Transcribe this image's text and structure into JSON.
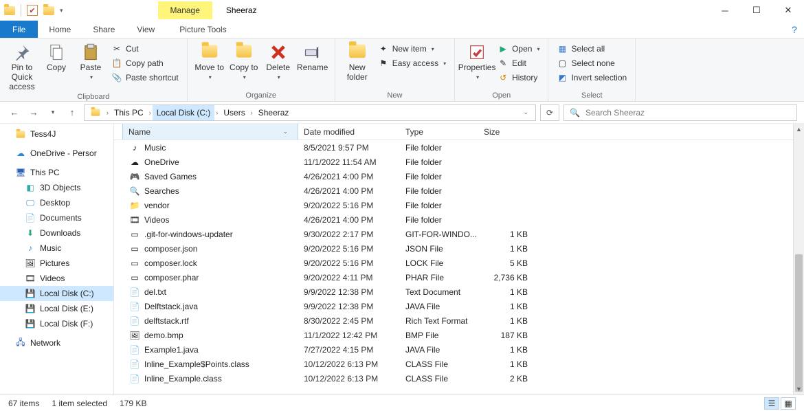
{
  "title": {
    "manage": "Manage",
    "pictureTools": "Picture Tools",
    "windowName": "Sheeraz"
  },
  "tabs": {
    "file": "File",
    "home": "Home",
    "share": "Share",
    "view": "View",
    "pictureTools": "Picture Tools"
  },
  "ribbon": {
    "clipboard": {
      "label": "Clipboard",
      "pin": "Pin to Quick access",
      "copy": "Copy",
      "paste": "Paste",
      "cut": "Cut",
      "copyPath": "Copy path",
      "pasteShortcut": "Paste shortcut"
    },
    "organize": {
      "label": "Organize",
      "moveTo": "Move to",
      "copyTo": "Copy to",
      "delete": "Delete",
      "rename": "Rename"
    },
    "new_": {
      "label": "New",
      "newFolder": "New folder",
      "newItem": "New item",
      "easyAccess": "Easy access"
    },
    "open_": {
      "label": "Open",
      "properties": "Properties",
      "open": "Open",
      "edit": "Edit",
      "history": "History"
    },
    "select_": {
      "label": "Select",
      "selectAll": "Select all",
      "selectNone": "Select none",
      "invert": "Invert selection"
    }
  },
  "breadcrumb": {
    "thisPc": "This PC",
    "drive": "Local Disk (C:)",
    "users": "Users",
    "folder": "Sheeraz"
  },
  "search": {
    "placeholder": "Search Sheeraz"
  },
  "nav": {
    "tess4j": "Tess4J",
    "onedrive": "OneDrive - Persor",
    "thisPc": "This PC",
    "objects3d": "3D Objects",
    "desktop": "Desktop",
    "documents": "Documents",
    "downloads": "Downloads",
    "music": "Music",
    "pictures": "Pictures",
    "videos": "Videos",
    "diskC": "Local Disk (C:)",
    "diskE": "Local Disk (E:)",
    "diskF": "Local Disk (F:)",
    "network": "Network"
  },
  "columns": {
    "name": "Name",
    "date": "Date modified",
    "type": "Type",
    "size": "Size"
  },
  "files": [
    {
      "icon": "music",
      "name": "Music",
      "date": "8/5/2021 9:57 PM",
      "type": "File folder",
      "size": ""
    },
    {
      "icon": "onedrive",
      "name": "OneDrive",
      "date": "11/1/2022 11:54 AM",
      "type": "File folder",
      "size": ""
    },
    {
      "icon": "games",
      "name": "Saved Games",
      "date": "4/26/2021 4:00 PM",
      "type": "File folder",
      "size": ""
    },
    {
      "icon": "search",
      "name": "Searches",
      "date": "4/26/2021 4:00 PM",
      "type": "File folder",
      "size": ""
    },
    {
      "icon": "folder",
      "name": "vendor",
      "date": "9/20/2022 5:16 PM",
      "type": "File folder",
      "size": ""
    },
    {
      "icon": "videos",
      "name": "Videos",
      "date": "4/26/2021 4:00 PM",
      "type": "File folder",
      "size": ""
    },
    {
      "icon": "file",
      "name": ".git-for-windows-updater",
      "date": "9/30/2022 2:17 PM",
      "type": "GIT-FOR-WINDO...",
      "size": "1 KB"
    },
    {
      "icon": "file",
      "name": "composer.json",
      "date": "9/20/2022 5:16 PM",
      "type": "JSON File",
      "size": "1 KB"
    },
    {
      "icon": "file",
      "name": "composer.lock",
      "date": "9/20/2022 5:16 PM",
      "type": "LOCK File",
      "size": "5 KB"
    },
    {
      "icon": "file",
      "name": "composer.phar",
      "date": "9/20/2022 4:11 PM",
      "type": "PHAR File",
      "size": "2,736 KB"
    },
    {
      "icon": "txt",
      "name": "del.txt",
      "date": "9/9/2022 12:38 PM",
      "type": "Text Document",
      "size": "1 KB"
    },
    {
      "icon": "java",
      "name": "Delftstack.java",
      "date": "9/9/2022 12:38 PM",
      "type": "JAVA File",
      "size": "1 KB"
    },
    {
      "icon": "rtf",
      "name": "delftstack.rtf",
      "date": "8/30/2022 2:45 PM",
      "type": "Rich Text Format",
      "size": "1 KB"
    },
    {
      "icon": "bmp",
      "name": "demo.bmp",
      "date": "11/1/2022 12:42 PM",
      "type": "BMP File",
      "size": "187 KB"
    },
    {
      "icon": "java",
      "name": "Example1.java",
      "date": "7/27/2022 4:15 PM",
      "type": "JAVA File",
      "size": "1 KB"
    },
    {
      "icon": "class",
      "name": "Inline_Example$Points.class",
      "date": "10/12/2022 6:13 PM",
      "type": "CLASS File",
      "size": "1 KB"
    },
    {
      "icon": "class",
      "name": "Inline_Example.class",
      "date": "10/12/2022 6:13 PM",
      "type": "CLASS File",
      "size": "2 KB"
    }
  ],
  "status": {
    "items": "67 items",
    "selected": "1 item selected",
    "size": "179 KB"
  }
}
